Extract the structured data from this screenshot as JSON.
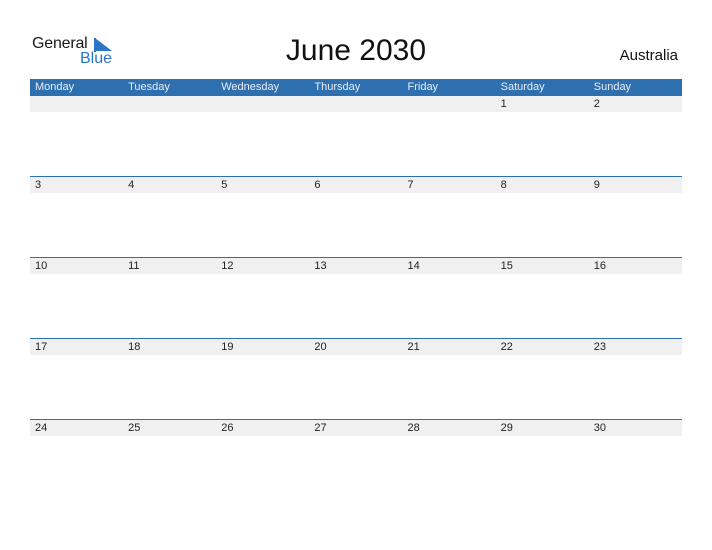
{
  "logo": {
    "word1": "General",
    "word2": "Blue"
  },
  "title": "June 2030",
  "country": "Australia",
  "colors": {
    "header": "#2e6fb0",
    "band": "#f0f0f0",
    "logo_blue": "#2a77c6"
  },
  "days": [
    "Monday",
    "Tuesday",
    "Wednesday",
    "Thursday",
    "Friday",
    "Saturday",
    "Sunday"
  ],
  "weeks": [
    [
      "",
      "",
      "",
      "",
      "",
      "1",
      "2"
    ],
    [
      "3",
      "4",
      "5",
      "6",
      "7",
      "8",
      "9"
    ],
    [
      "10",
      "11",
      "12",
      "13",
      "14",
      "15",
      "16"
    ],
    [
      "17",
      "18",
      "19",
      "20",
      "21",
      "22",
      "23"
    ],
    [
      "24",
      "25",
      "26",
      "27",
      "28",
      "29",
      "30"
    ]
  ]
}
